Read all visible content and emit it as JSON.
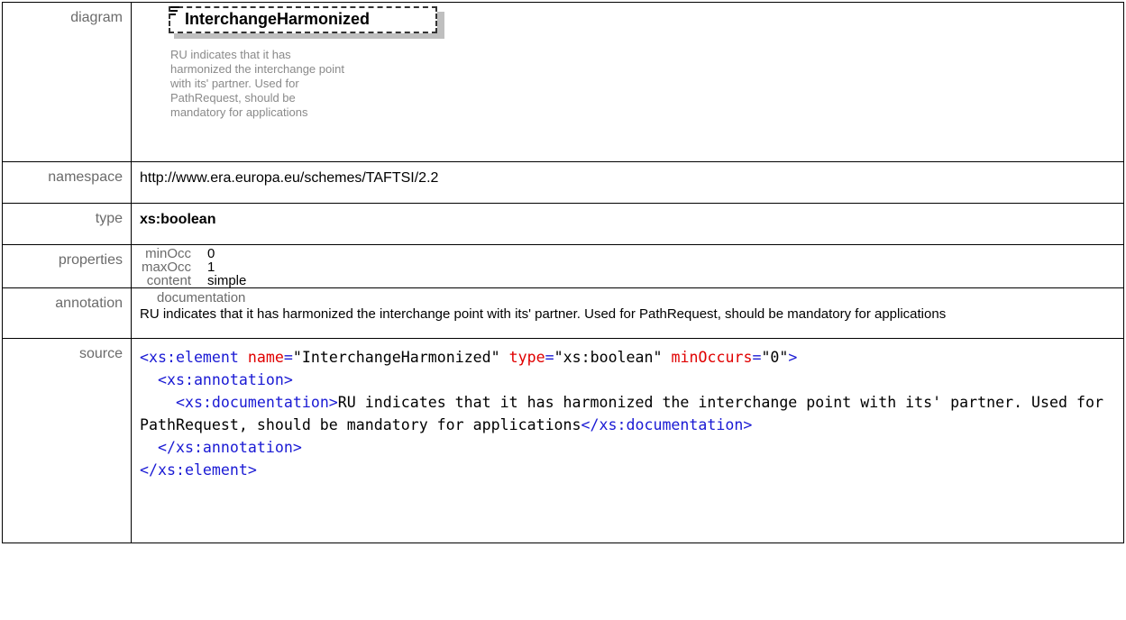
{
  "labels": {
    "diagram": "diagram",
    "namespace": "namespace",
    "type": "type",
    "properties": "properties",
    "annotation": "annotation",
    "source": "source"
  },
  "diagram": {
    "element_name": "InterchangeHarmonized",
    "doc_lines": [
      "RU indicates that it has",
      "harmonized the interchange point",
      "with its' partner. Used for",
      "PathRequest, should be",
      "mandatory for applications"
    ]
  },
  "namespace": "http://www.era.europa.eu/schemes/TAFTSI/2.2",
  "type": "xs:boolean",
  "properties": [
    {
      "key": "minOcc",
      "value": "0"
    },
    {
      "key": "maxOcc",
      "value": "1"
    },
    {
      "key": "content",
      "value": "simple"
    }
  ],
  "annotation": {
    "heading": "documentation",
    "text": "RU indicates that it has harmonized the interchange point with its' partner. Used for PathRequest, should be mandatory for applications"
  },
  "source": {
    "el_open": "<xs:element",
    "attr_name": "name",
    "attr_name_val": "\"InterchangeHarmonized\"",
    "attr_type": "type",
    "attr_type_val": "\"xs:boolean\"",
    "attr_min": "minOccurs",
    "attr_min_val": "\"0\"",
    "ann_open": "<xs:annotation>",
    "doc_open": "<xs:documentation>",
    "doc_text": "RU indicates that it has harmonized the interchange point with its' partner. Used for PathRequest, should be mandatory for applications",
    "doc_close": "</xs:documentation>",
    "ann_close": "</xs:annotation>",
    "el_close": "</xs:element>"
  }
}
